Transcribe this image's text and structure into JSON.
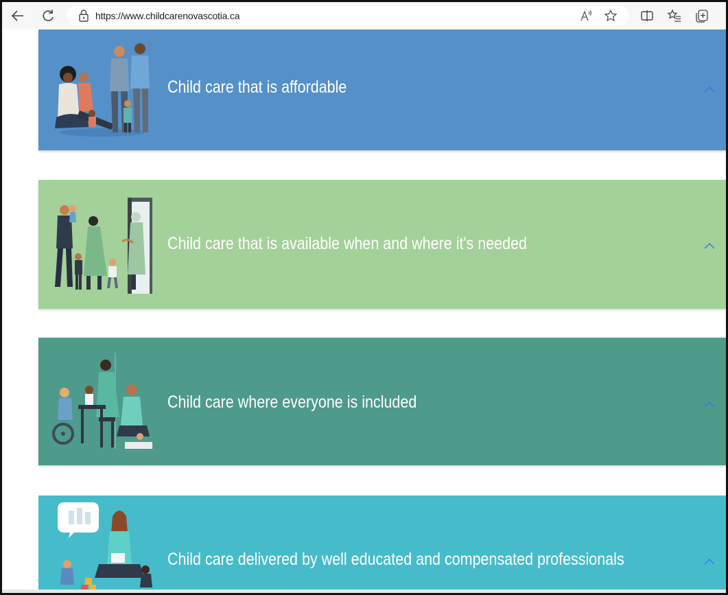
{
  "browser": {
    "url": "https://www.childcarenovascotia.ca",
    "icons": [
      "back-arrow-icon",
      "reload-icon",
      "lock-icon",
      "read-aloud-icon",
      "favorite-star-icon",
      "split-screen-icon",
      "favorites-icon",
      "collections-icon"
    ]
  },
  "cards": [
    {
      "title": "Child care that is affordable",
      "color": "#5590c9",
      "chevron_color": "#3a7fd0"
    },
    {
      "title": "Child care that is available when and where it's needed",
      "color": "#a4d09a",
      "chevron_color": "#3a7fd0"
    },
    {
      "title": "Child care where everyone is included",
      "color": "#4e9a8b",
      "chevron_color": "#3a7fd0"
    },
    {
      "title": "Child care delivered by well educated and compensated professionals",
      "color": "#46bccb",
      "chevron_color": "#3a7fd0"
    }
  ]
}
